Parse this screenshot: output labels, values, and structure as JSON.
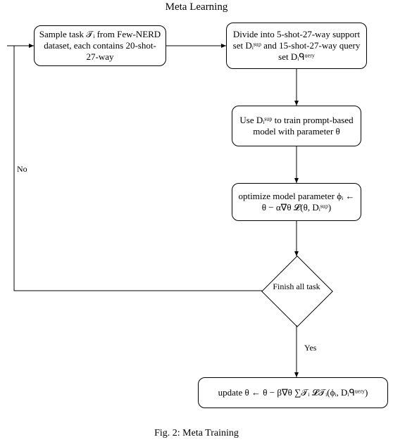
{
  "title": "Meta Learning",
  "caption": "Fig. 2: Meta Training",
  "nodes": {
    "sample": "Sample task 𝒯ᵢ from Few-NERD dataset, each contains 20-shot-27-way",
    "divide": "Divide into 5-shot-27-way support set Dᵢˢᵘᵖ  and 15-shot-27-way query set Dᵢᑫᵘᵉʳʸ",
    "train": "Use Dᵢˢᵘᵖ to train prompt-based model with parameter θ",
    "optimize": "optimize model parameter ϕᵢ ← θ − α∇θ 𝓛(θ, Dᵢˢᵘᵖ)",
    "decision": "Finish all task",
    "update": "update θ ← θ − β∇θ ∑𝒯ᵢ 𝓛𝒯ᵢ(ϕᵢ, Dᵢᑫᵘᵉʳʸ)"
  },
  "edges": {
    "no": "No",
    "yes": "Yes"
  }
}
